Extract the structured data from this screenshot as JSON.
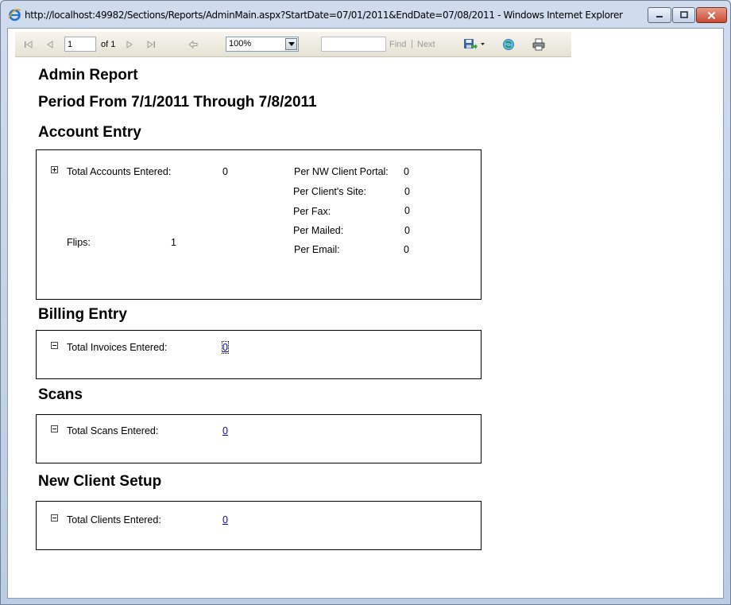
{
  "window": {
    "title": "http://localhost:49982/Sections/Reports/AdminMain.aspx?StartDate=07/01/2011&EndDate=07/08/2011 - Windows Internet Explorer"
  },
  "toolbar": {
    "page_value": "1",
    "page_of": "of 1",
    "zoom": "100%",
    "find_value": "",
    "find_label": "Find",
    "separator": "|",
    "next_label": "Next"
  },
  "report": {
    "title": "Admin Report",
    "period": "Period From 7/1/2011 Through 7/8/2011",
    "account_entry": {
      "heading": "Account Entry",
      "total_label": "Total Accounts Entered:",
      "total_value": "0",
      "flips_label": "Flips:",
      "flips_value": "1",
      "rows": [
        {
          "label": "Per NW Client Portal:",
          "value": "0"
        },
        {
          "label": "Per Client's Site:",
          "value": "0"
        },
        {
          "label": "Per Fax:",
          "value": "0"
        },
        {
          "label": "Per Mailed:",
          "value": "0"
        },
        {
          "label": "Per Email:",
          "value": "0"
        }
      ]
    },
    "billing_entry": {
      "heading": "Billing Entry",
      "label": "Total Invoices Entered:",
      "value": "0"
    },
    "scans": {
      "heading": "Scans",
      "label": "Total Scans Entered:",
      "value": "0"
    },
    "new_client": {
      "heading": "New Client Setup",
      "label": "Total Clients Entered:",
      "value": "0"
    }
  }
}
